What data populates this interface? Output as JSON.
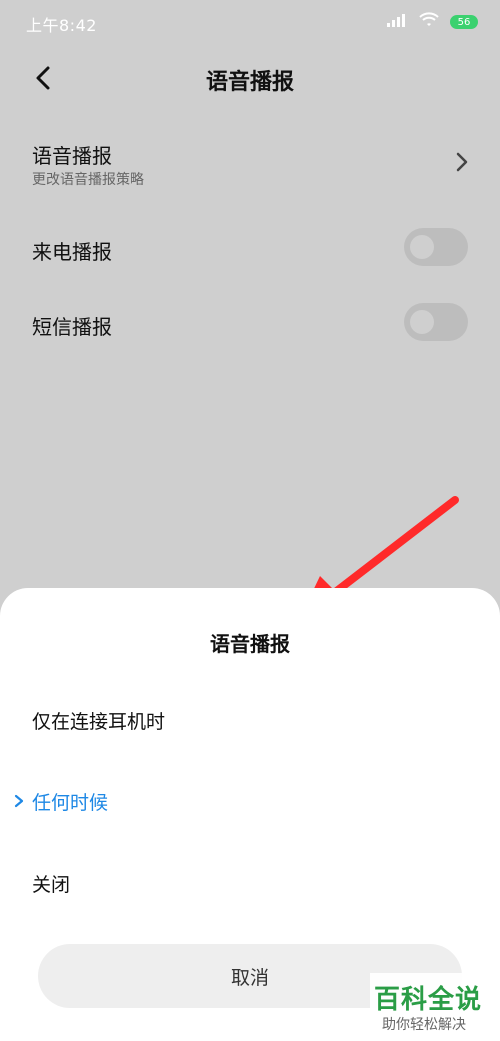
{
  "status_bar": {
    "time": "上午8:42",
    "battery_level": "56",
    "icons": [
      "signal-icon",
      "wifi-icon",
      "battery-icon"
    ]
  },
  "header": {
    "title": "语音播报"
  },
  "settings": {
    "items": [
      {
        "title": "语音播报",
        "subtitle": "更改语音播报策略",
        "type": "link"
      },
      {
        "title": "来电播报",
        "type": "toggle",
        "enabled": false
      },
      {
        "title": "短信播报",
        "type": "toggle",
        "enabled": false
      }
    ]
  },
  "sheet": {
    "title": "语音播报",
    "options": [
      {
        "label": "仅在连接耳机时",
        "selected": false
      },
      {
        "label": "任何时候",
        "selected": true
      },
      {
        "label": "关闭",
        "selected": false
      }
    ],
    "cancel_label": "取消"
  },
  "colors": {
    "accent": "#1e88e5",
    "overlay_bg": "#cfcfcf",
    "sheet_bg": "#ffffff",
    "annotation": "#ff2a2a",
    "watermark": "#2a9d46"
  },
  "watermark": {
    "title": "百科全说",
    "subtitle": "助你轻松解决"
  }
}
